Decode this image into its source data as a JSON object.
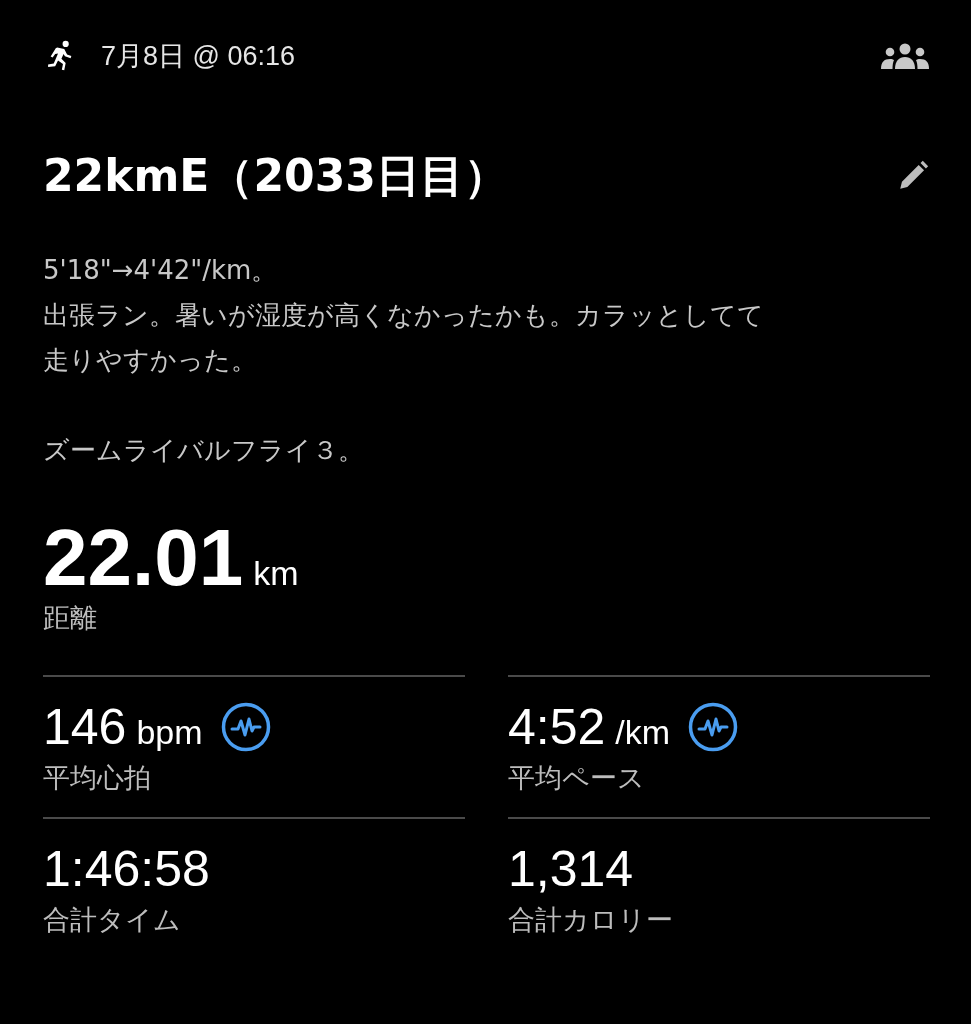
{
  "header": {
    "date": "7月8日 @ 06:16"
  },
  "title": "22kmE（2033日目）",
  "notes": [
    {
      "lines": [
        "5'18\"→4'42\"/km。",
        "出張ラン。暑いが湿度が高くなかったかも。カラッとしてて",
        "走りやすかった。"
      ]
    },
    {
      "lines": [
        "ズームライバルフライ３。"
      ]
    }
  ],
  "distance": {
    "value": "22.01",
    "unit": "km",
    "label": "距離"
  },
  "stats": [
    {
      "value": "146",
      "unit": "bpm",
      "label": "平均心拍",
      "chart_icon": true
    },
    {
      "value": "4:52",
      "unit": "/km",
      "label": "平均ペース",
      "chart_icon": true
    },
    {
      "value": "1:46:58",
      "label": "合計タイム",
      "chart_icon": false
    },
    {
      "value": "1,314",
      "label": "合計カロリー",
      "chart_icon": false
    }
  ]
}
